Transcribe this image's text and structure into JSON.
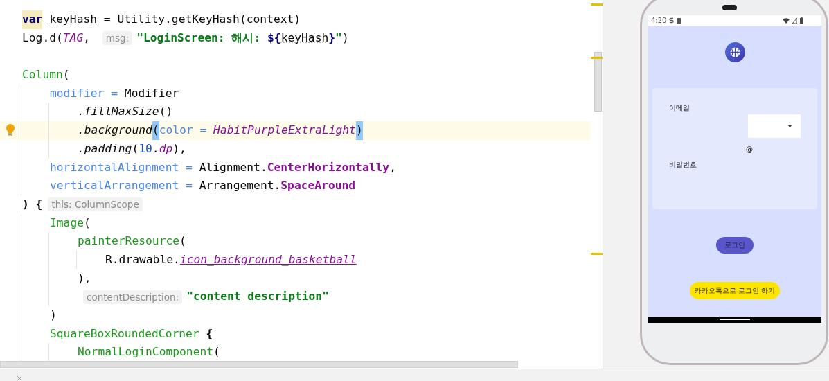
{
  "editor": {
    "lines": [
      {
        "current": false,
        "tokens": [
          {
            "text": "var",
            "kind": "keyword-marked"
          },
          {
            "text": "keyHash",
            "kind": "var-decl"
          },
          {
            "text": " = Utility.getKeyHash(context)",
            "kind": "plain"
          }
        ]
      },
      {
        "current": false,
        "tokens": [
          {
            "text": "Log.d(",
            "kind": "plain"
          },
          {
            "text": "TAG",
            "kind": "constant"
          },
          {
            "text": ", ",
            "kind": "plain"
          },
          {
            "text": "msg:",
            "kind": "hint"
          },
          {
            "text": "\"LoginScreen: 해시: ",
            "kind": "string"
          },
          {
            "text": "${",
            "kind": "template"
          },
          {
            "text": "keyHash",
            "kind": "template-var"
          },
          {
            "text": "}",
            "kind": "template"
          },
          {
            "text": "\"",
            "kind": "string"
          },
          {
            "text": ")",
            "kind": "plain"
          }
        ]
      },
      {
        "current": false
      },
      {
        "current": false,
        "tokens": [
          {
            "text": "Column",
            "kind": "composable"
          },
          {
            "text": "(",
            "kind": "plain"
          }
        ],
        "children": [
          {
            "current": false,
            "tokens": [
              {
                "text": "modifier",
                "kind": "param"
              },
              {
                "text": " = ",
                "kind": "param"
              },
              {
                "text": "Modifier",
                "kind": "plain"
              }
            ],
            "children": [
              {
                "current": false,
                "tokens": [
                  {
                    "text": ".fillMaxSize",
                    "kind": "extension"
                  },
                  {
                    "text": "()",
                    "kind": "plain"
                  }
                ]
              },
              {
                "current": true,
                "tokens": [
                  {
                    "text": ".background",
                    "kind": "extension"
                  },
                  {
                    "text": "(",
                    "kind": "bracket-match"
                  },
                  {
                    "text": "color = ",
                    "kind": "param"
                  },
                  {
                    "text": "HabitPurpleExtraLight",
                    "kind": "constant"
                  },
                  {
                    "text": ")",
                    "kind": "bracket-match"
                  }
                ]
              },
              {
                "current": false,
                "tokens": [
                  {
                    "text": ".padding",
                    "kind": "extension"
                  },
                  {
                    "text": "(",
                    "kind": "plain"
                  },
                  {
                    "text": "10",
                    "kind": "number"
                  },
                  {
                    "text": ".",
                    "kind": "plain"
                  },
                  {
                    "text": "dp",
                    "kind": "constant"
                  },
                  {
                    "text": "),",
                    "kind": "plain"
                  }
                ]
              }
            ]
          },
          {
            "current": false,
            "tokens": [
              {
                "text": "horizontalAlignment = ",
                "kind": "param"
              },
              {
                "text": "Alignment.",
                "kind": "plain"
              },
              {
                "text": "CenterHorizontally",
                "kind": "enum"
              },
              {
                "text": ",",
                "kind": "plain"
              }
            ]
          },
          {
            "current": false,
            "tokens": [
              {
                "text": "verticalArrangement = ",
                "kind": "param"
              },
              {
                "text": "Arrangement.",
                "kind": "plain"
              },
              {
                "text": "SpaceAround",
                "kind": "enum"
              }
            ]
          }
        ]
      },
      {
        "current": false,
        "tokens": [
          {
            "text": ") {",
            "kind": "brace"
          },
          {
            "text": "this: ColumnScope",
            "kind": "hint"
          }
        ],
        "children": [
          {
            "current": false,
            "tokens": [
              {
                "text": "Image",
                "kind": "composable"
              },
              {
                "text": "(",
                "kind": "plain"
              }
            ],
            "children": [
              {
                "current": false,
                "tokens": [
                  {
                    "text": "painterResource",
                    "kind": "composable"
                  },
                  {
                    "text": "(",
                    "kind": "plain"
                  }
                ],
                "children": [
                  {
                    "current": false,
                    "tokens": [
                      {
                        "text": "R.drawable.",
                        "kind": "plain"
                      },
                      {
                        "text": "icon_background_basketball",
                        "kind": "resource"
                      }
                    ]
                  }
                ]
              },
              {
                "current": false,
                "tokens": [
                  {
                    "text": "),",
                    "kind": "plain"
                  }
                ]
              },
              {
                "current": false,
                "tokens": [
                  {
                    "text": "contentDescription:",
                    "kind": "hint"
                  },
                  {
                    "text": "\"content description\"",
                    "kind": "string"
                  }
                ]
              }
            ]
          },
          {
            "current": false,
            "tokens": [
              {
                "text": ")",
                "kind": "plain"
              }
            ]
          },
          {
            "current": false,
            "tokens": [
              {
                "text": "SquareBoxRoundedCorner",
                "kind": "composable"
              },
              {
                "text": " {",
                "kind": "brace"
              }
            ],
            "children": [
              {
                "current": false,
                "tokens": [
                  {
                    "text": "NormalLoginComponent",
                    "kind": "composable"
                  },
                  {
                    "text": "(",
                    "kind": "plain"
                  }
                ]
              }
            ]
          }
        ]
      }
    ]
  },
  "phone": {
    "status_bar": {
      "time": "4:20"
    },
    "screen": {
      "email_label": "이메일",
      "at_sign": "@",
      "password_label": "비밀번호",
      "login_button": "로그인",
      "kakao_button": "카카오톡으로 로그인 하기"
    }
  }
}
